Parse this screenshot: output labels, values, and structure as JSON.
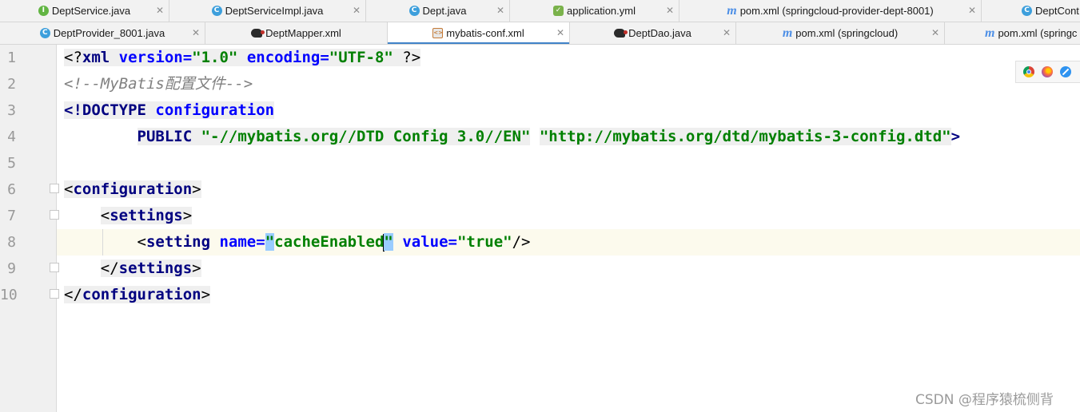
{
  "tabs_row1": [
    {
      "label": "DeptService.java",
      "icon": "interface-icon"
    },
    {
      "label": "DeptServiceImpl.java",
      "icon": "class-icon"
    },
    {
      "label": "Dept.java",
      "icon": "class-icon"
    },
    {
      "label": "application.yml",
      "icon": "yaml-icon"
    },
    {
      "label": "pom.xml (springcloud-provider-dept-8001)",
      "icon": "maven-icon"
    },
    {
      "label": "DeptCont",
      "icon": "class-icon"
    }
  ],
  "tabs_row2": [
    {
      "label": "DeptProvider_8001.java",
      "icon": "spring-class-icon"
    },
    {
      "label": "DeptMapper.xml",
      "icon": "mybatis-icon"
    },
    {
      "label": "mybatis-conf.xml",
      "icon": "xml-icon",
      "active": true
    },
    {
      "label": "DeptDao.java",
      "icon": "mybatis-icon"
    },
    {
      "label": "pom.xml (springcloud)",
      "icon": "maven-icon"
    },
    {
      "label": "pom.xml (springc",
      "icon": "maven-icon"
    }
  ],
  "editor": {
    "line_numbers": [
      "1",
      "2",
      "3",
      "4",
      "5",
      "6",
      "7",
      "8",
      "9",
      "10"
    ],
    "current_line": 8,
    "lines": {
      "l1": {
        "a": "<?",
        "b": "xml",
        "c": " version=",
        "d": "\"1.0\"",
        "e": " encoding=",
        "f": "\"UTF-8\"",
        "g": " ?>"
      },
      "l2": {
        "text": "<!--MyBatis配置文件-->"
      },
      "l3": {
        "a": "<!DOCTYPE ",
        "b": "configuration"
      },
      "l4": {
        "a": "PUBLIC ",
        "b": "\"-//mybatis.org//DTD Config 3.0//EN\"",
        "c": " ",
        "d": "\"http://mybatis.org/dtd/mybatis-3-config.dtd\"",
        "e": ">"
      },
      "l6": {
        "a": "<",
        "b": "configuration",
        "c": ">"
      },
      "l7": {
        "a": "<",
        "b": "settings",
        "c": ">"
      },
      "l8": {
        "a": "<",
        "b": "setting",
        "c": " name=",
        "d": "\"",
        "e": "cacheEnabled",
        "f": "\"",
        "g": " value=",
        "h": "\"true\"",
        "i": "/>"
      },
      "l9": {
        "a": "</",
        "b": "settings",
        "c": ">"
      },
      "l10": {
        "a": "</",
        "b": "configuration",
        "c": ">"
      }
    }
  },
  "browser_icons": [
    "chrome-icon",
    "firefox-icon",
    "safari-icon"
  ],
  "watermark": "CSDN @程序猿梳侧背"
}
